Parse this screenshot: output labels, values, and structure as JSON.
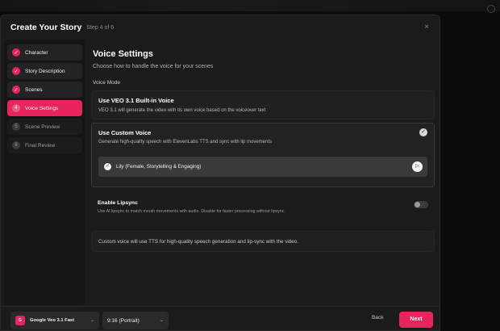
{
  "modal": {
    "title": "Create Your Story",
    "step_indicator": "Step 4 of 6",
    "close_glyph": "×"
  },
  "sidebar": {
    "steps": [
      {
        "label": "Character",
        "status": "done",
        "marker": "✓"
      },
      {
        "label": "Story Description",
        "status": "done",
        "marker": "✓"
      },
      {
        "label": "Scenes",
        "status": "done",
        "marker": "✓"
      },
      {
        "label": "Voice Settings",
        "status": "active",
        "marker": "4"
      },
      {
        "label": "Scene Preview",
        "status": "pending",
        "marker": "5"
      },
      {
        "label": "Final Review",
        "status": "pending",
        "marker": "6"
      }
    ]
  },
  "content": {
    "title": "Voice Settings",
    "subtitle": "Choose how to handle the voice for your scenes",
    "voice_mode_label": "Voice Mode",
    "builtin": {
      "title": "Use VEO 3.1 Built-in Voice",
      "description": "VEO 3.1 will generate the video with its own voice based on the voiceover text"
    },
    "custom": {
      "title": "Use Custom Voice",
      "description": "Generate high-quality speech with ElevenLabs TTS and sync with lip movements",
      "selected": true,
      "check_glyph": "✓",
      "voice": {
        "label": "Lily (Female, Storytelling & Engaging)",
        "check_glyph": "✓",
        "play_glyph": "▷"
      }
    },
    "lipsync": {
      "title": "Enable Lipsync",
      "description": "Use AI lipsync to match mouth movements with audio. Disable for faster processing without lipsync.",
      "enabled": false
    },
    "info": "Custom voice will use TTS for high-quality speech generation and lip-sync with the video."
  },
  "footer": {
    "model": {
      "logo_text": "G",
      "label": "Google Veo 3.1 Fast",
      "chevron": "⌄"
    },
    "aspect_ratio": {
      "label": "9:16 (Portrait)",
      "chevron": "⌄"
    },
    "back_label": "Back",
    "next_label": "Next"
  },
  "colors": {
    "accent": "#e8245c",
    "modal_bg": "#1b1b1d",
    "sidebar_bg": "#151517",
    "card_bg": "#202023"
  }
}
